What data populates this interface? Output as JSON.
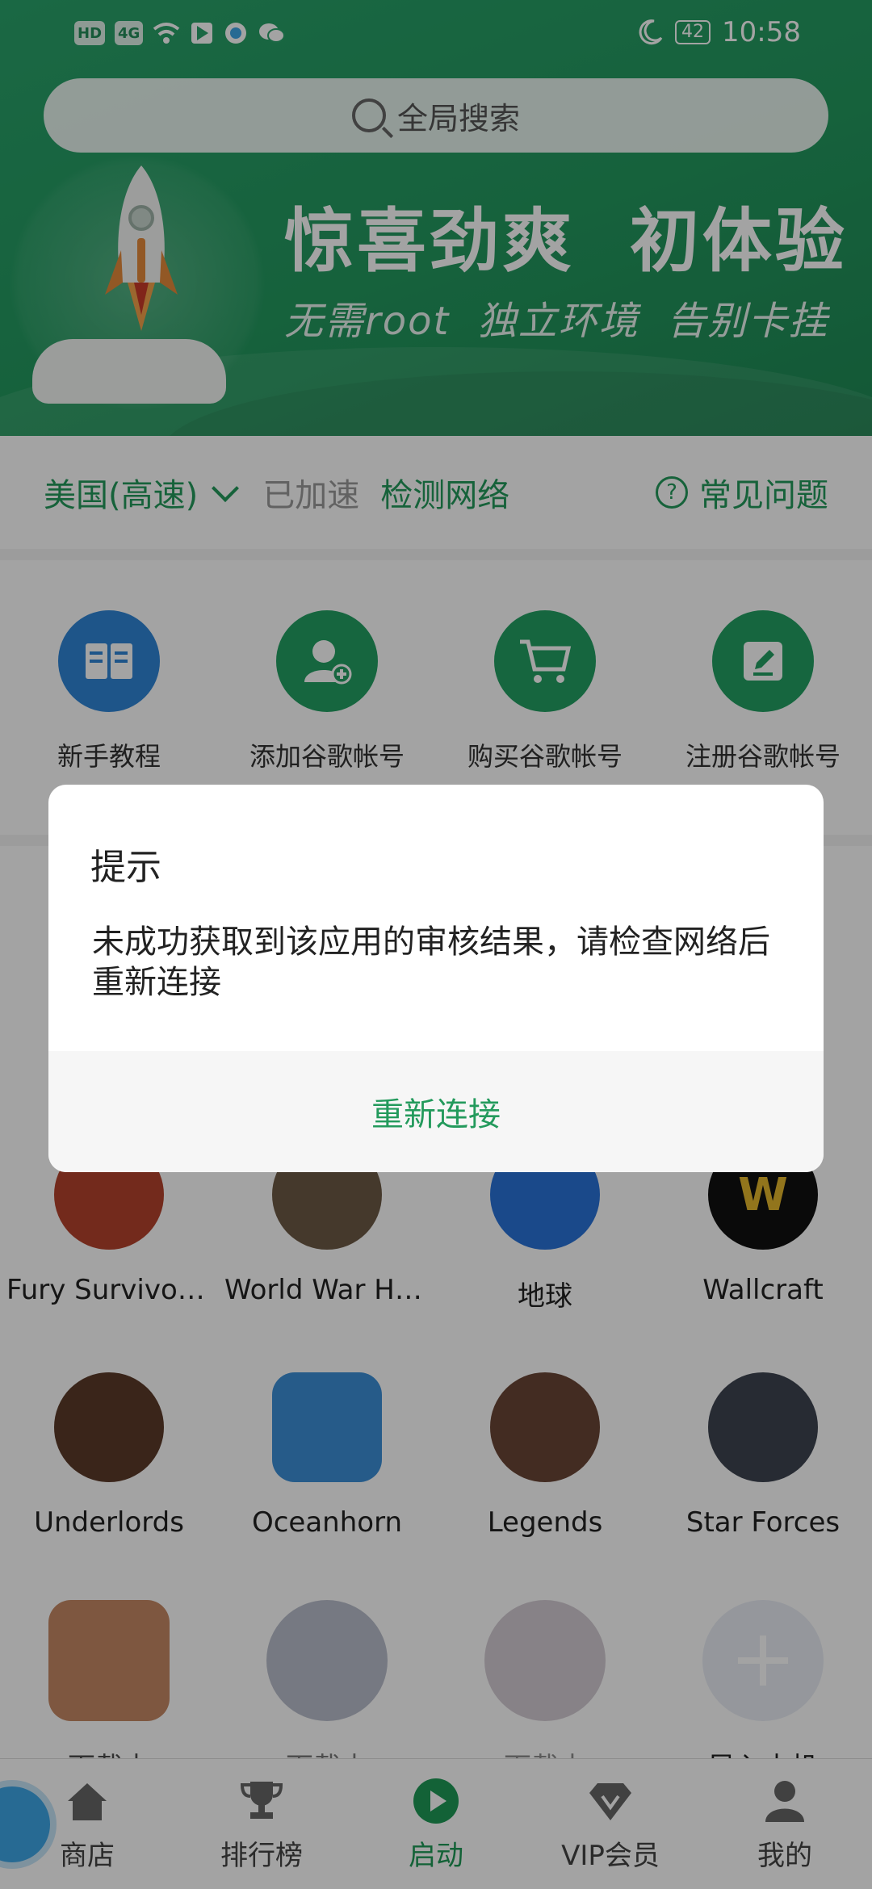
{
  "status_bar": {
    "time": "10:58",
    "battery": "42",
    "left_icons": [
      "HD",
      "4G"
    ]
  },
  "search": {
    "placeholder": "全局搜索"
  },
  "banner": {
    "headline": "惊喜劲爽  初体验",
    "subline": "无需root  独立环境  告别卡挂"
  },
  "network": {
    "region": "美国(高速)",
    "status": "已加速",
    "check": "检测网络",
    "faq": "常见问题"
  },
  "quick_actions": [
    {
      "label": "新手教程",
      "icon": "book-icon",
      "color": "#2f86d6"
    },
    {
      "label": "添加谷歌帐号",
      "icon": "add-user-icon",
      "color": "#23a063"
    },
    {
      "label": "购买谷歌帐号",
      "icon": "cart-icon",
      "color": "#23a063"
    },
    {
      "label": "注册谷歌帐号",
      "icon": "edit-icon",
      "color": "#23a063"
    }
  ],
  "apps": [
    {
      "label": "Fury Survivor: ...",
      "color": "#b5432c"
    },
    {
      "label": "World War He...",
      "color": "#6d5a45"
    },
    {
      "label": "地球",
      "color": "#2a73d8"
    },
    {
      "label": "Wallcraft",
      "color": "#111111"
    },
    {
      "label": "Underlords",
      "color": "#5c3b2a"
    },
    {
      "label": "Oceanhorn",
      "color": "#3c8fd6"
    },
    {
      "label": "Legends",
      "color": "#6a4536"
    },
    {
      "label": "Star Forces",
      "color": "#3d4450"
    },
    {
      "label": "下载中",
      "color": "#b66b3f"
    },
    {
      "label": "下载中",
      "color": "#8a93a8"
    },
    {
      "label": "下载中",
      "color": "#a89aa7"
    },
    {
      "label": "导入本机",
      "color": "#e9edf5"
    }
  ],
  "bottom_nav": [
    {
      "label": "商店",
      "icon": "home-icon",
      "active": false
    },
    {
      "label": "排行榜",
      "icon": "trophy-icon",
      "active": false
    },
    {
      "label": "启动",
      "icon": "play-icon",
      "active": true
    },
    {
      "label": "VIP会员",
      "icon": "vip-diamond-icon",
      "active": false
    },
    {
      "label": "我的",
      "icon": "profile-icon",
      "active": false
    }
  ],
  "dialog": {
    "title": "提示",
    "message": "未成功获取到该应用的审核结果，请检查网络后重新连接",
    "button": "重新连接"
  },
  "colors": {
    "brand_green": "#239a5c",
    "accent_blue": "#2f86d6"
  }
}
